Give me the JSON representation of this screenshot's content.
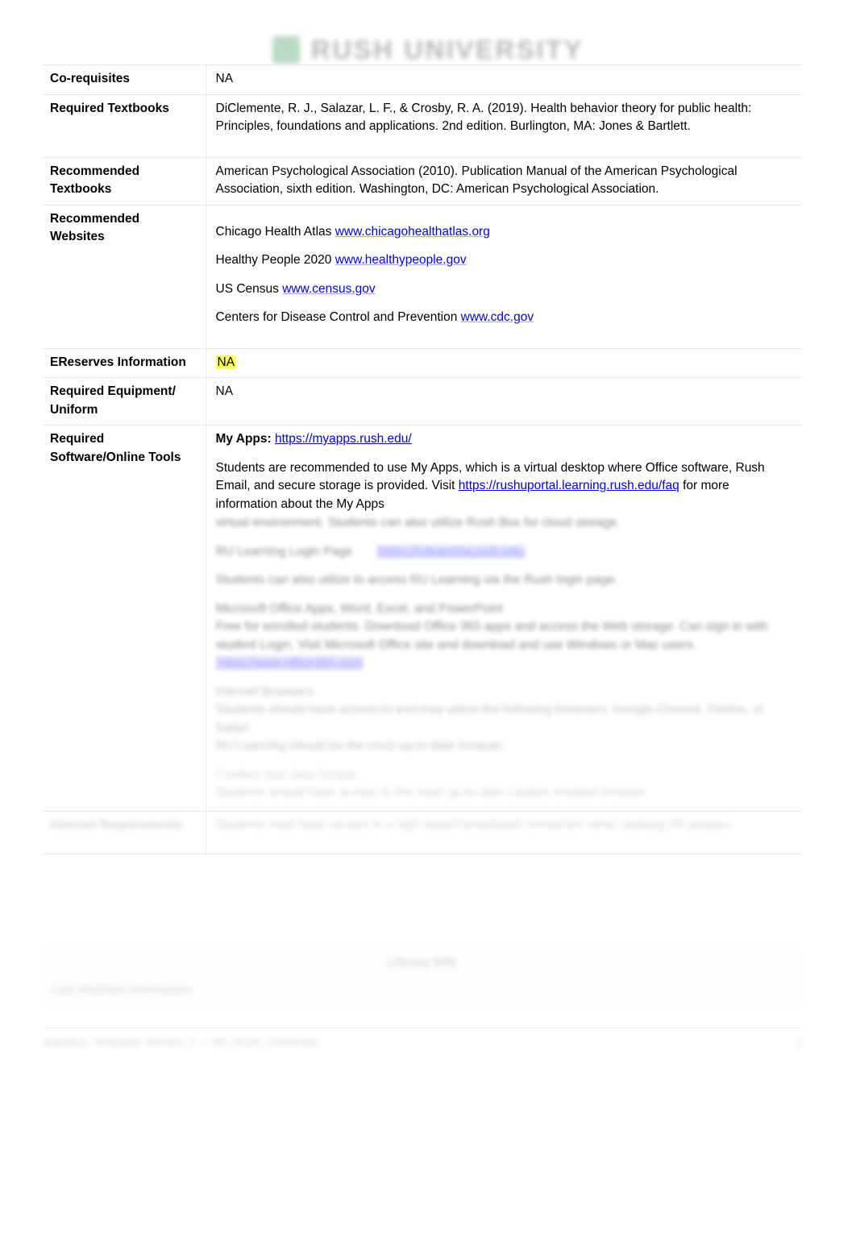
{
  "document": {
    "masthead": {
      "logo_wordmark": "RUSH UNIVERSITY",
      "logo_mark_color": "#8fc3a1"
    },
    "colors": {
      "link": "#0000f0",
      "highlight": "#ffff4d",
      "rule": "#e9e9e9"
    },
    "table": {
      "rows": [
        {
          "label": "Co-requisites",
          "value": "NA"
        },
        {
          "label": "Required Textbooks",
          "value": "DiClemente, R. J., Salazar, L. F., & Crosby, R. A. (2019). Health behavior theory for public health: Principles, foundations and applications. 2nd edition. Burlington, MA: Jones & Bartlett."
        },
        {
          "label": "Recommended Textbooks",
          "value": "American Psychological Association (2010). Publication Manual of the American Psychological Association, sixth edition. Washington, DC: American Psychological Association."
        },
        {
          "label": "Recommended Websites",
          "sites": [
            {
              "name": "Chicago Health Atlas",
              "url": "www.chicagohealthatlas.org"
            },
            {
              "name": "Healthy People 2020",
              "url": "www.healthypeople.gov"
            },
            {
              "name": "US Census",
              "url": "www.census.gov"
            },
            {
              "name": "Centers for Disease Control and Prevention",
              "url": "www.cdc.gov"
            }
          ]
        },
        {
          "label": "EReserves Information",
          "value": "NA",
          "highlighted": true
        },
        {
          "label": "Required Equipment/ Uniform",
          "value": "NA"
        },
        {
          "label": "Required Software/Online Tools",
          "myapps_label": "My Apps:",
          "myapps_url": "https://myapps.rush.edu/",
          "paragraph_a": "Students are recommended to use My Apps, which is a virtual desktop where Office software, Rush Email, and secure storage is provided.  Visit",
          "paragraph_a_link": "https://rushuportal.learning.rush.edu/faq",
          "paragraph_a_tail": "for more information about the My Apps"
        }
      ]
    },
    "obscured": {
      "note": "The following content is blurred/illegible in the source image.",
      "line_1": "virtual environment. Students can also utilize Rush Box for cloud storage.",
      "line_2_label": "RU Learning Login Page",
      "line_2_link": "https://rulearning.rush.edu",
      "line_3": "Students can also utilize to access RU Learning via the Rush login page.",
      "block_2_title": "Microsoft Office Apps, Word, Excel, and PowerPoint",
      "block_2_body": "Free for enrolled students. Download Office 365 apps and access the Web storage. Can sign in with student Login. Visit Microsoft Office site and download and use Windows or Mac users.",
      "block_2_link": "https://www.office365.com",
      "block_3_title": "Internet Browsers",
      "block_3_body": "Students should have access to and may utilize the following browsers: Google Chrome, Firefox, or Safari.",
      "block_3_link": "RU Learning should be the most up-to-date browser.",
      "block_4_title": "Cookies and Java Scripts",
      "block_4_body": "Students should have access to the most up-to-date cookies enabled browser.",
      "row_8_label": "Internet Requirements",
      "row_8_value": "Students must have access to a high-speed broadband connection when working off campus.",
      "band_title": "Library Info",
      "band_subtitle": "Last Modified Information",
      "footer_left": "Syllabus Template Version 2 — RU Rush University",
      "footer_right": "1"
    }
  }
}
